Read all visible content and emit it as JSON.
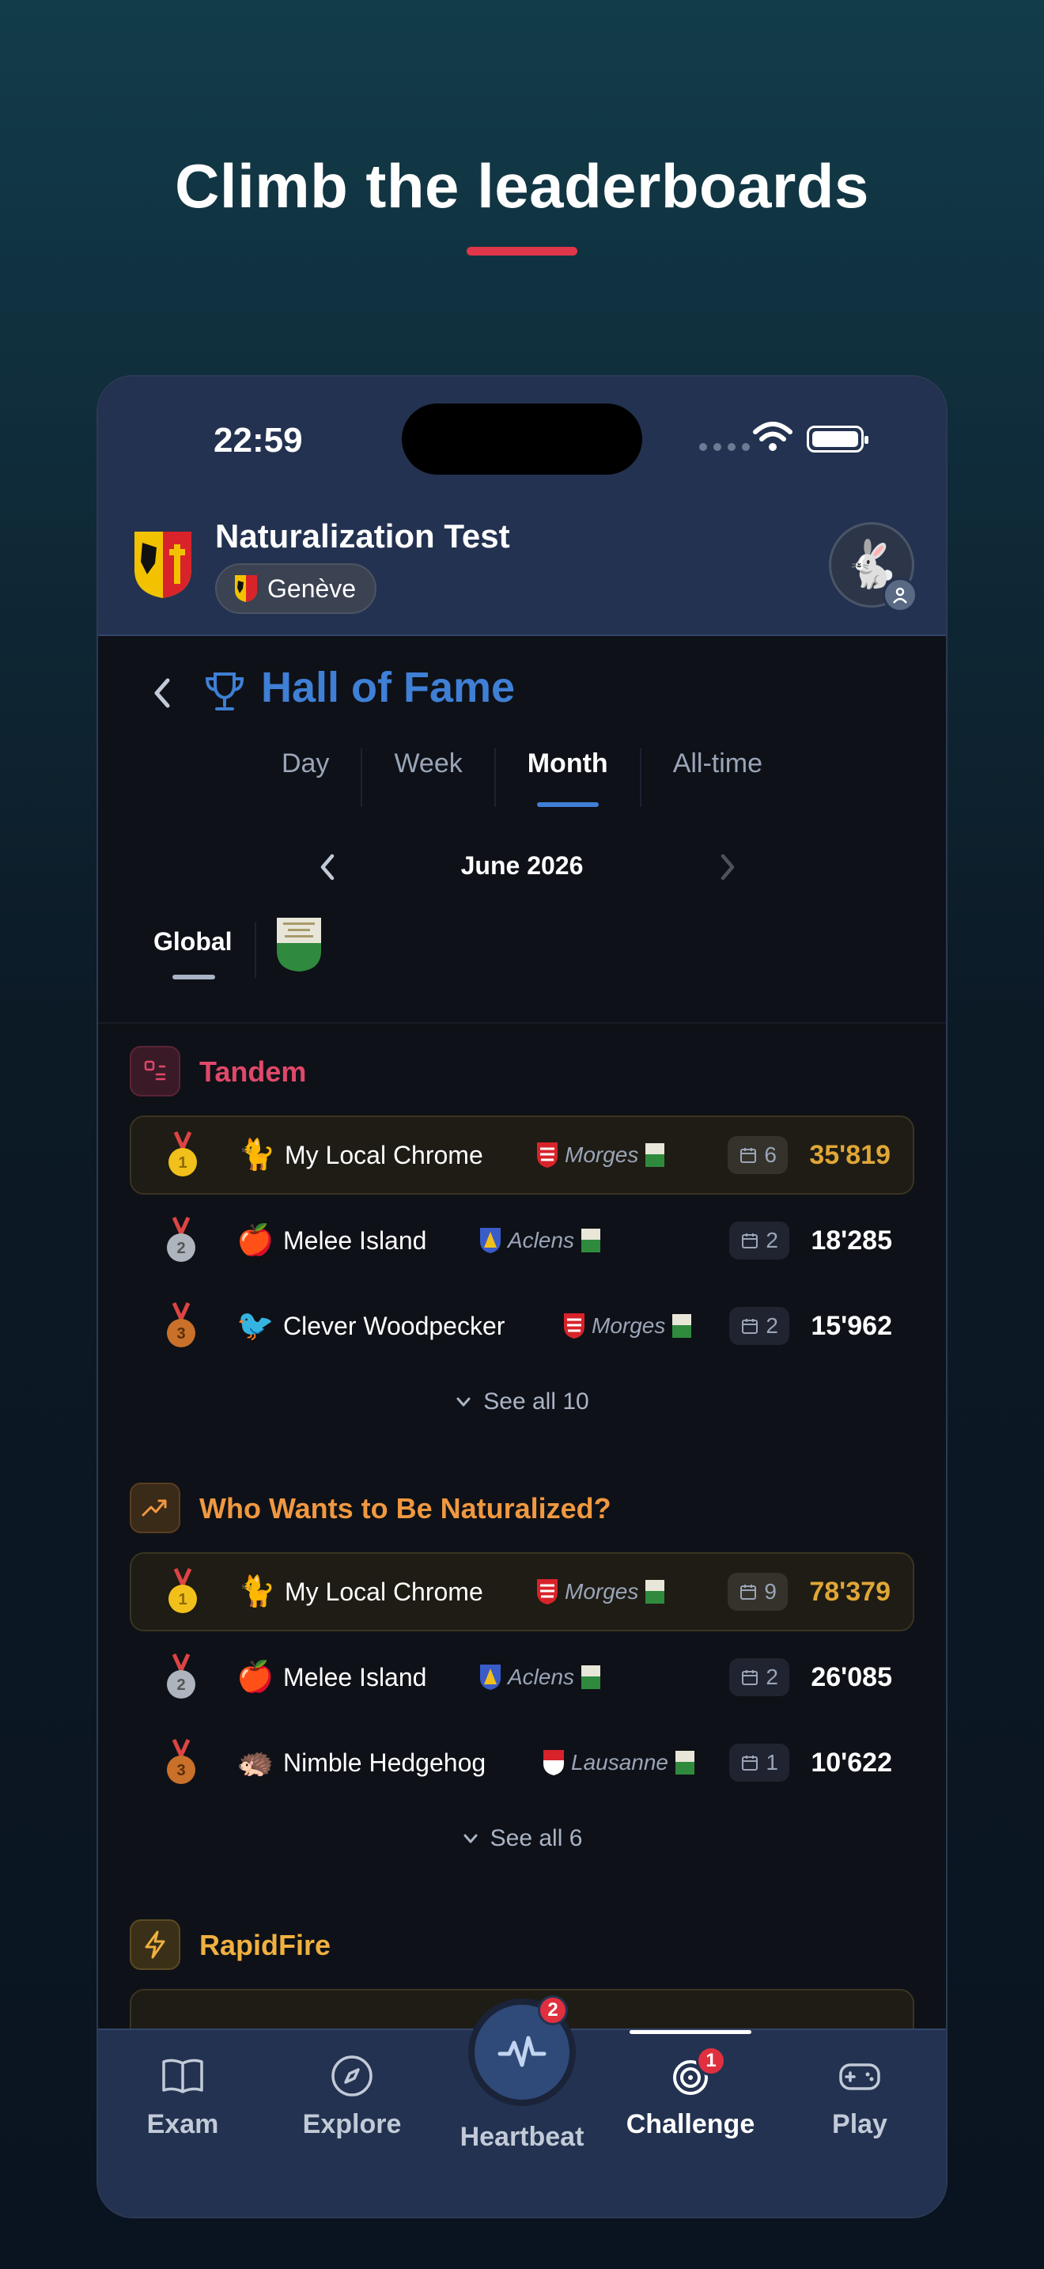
{
  "headline": "Climb the leaderboards",
  "status_bar": {
    "time": "22:59"
  },
  "header": {
    "app_title": "Naturalization Test",
    "canton": "Genève",
    "colors": {
      "bar": "#233250",
      "accent": "#3f7fd6"
    }
  },
  "page": {
    "title": "Hall of Fame",
    "tabs": [
      {
        "label": "Day",
        "active": false
      },
      {
        "label": "Week",
        "active": false
      },
      {
        "label": "Month",
        "active": true
      },
      {
        "label": "All-time",
        "active": false
      }
    ],
    "period": "June 2026",
    "scope_global": "Global"
  },
  "sections": [
    {
      "title": "Tandem",
      "color": "#e0486a",
      "icon": "puzzle-icon",
      "rows": [
        {
          "rank": 1,
          "animal": "🐈",
          "name": "My Local Chrome",
          "location": "Morges",
          "days": "6",
          "score": "35'819"
        },
        {
          "rank": 2,
          "animal": "🍎",
          "name": "Melee Island",
          "location": "Aclens",
          "days": "2",
          "score": "18'285"
        },
        {
          "rank": 3,
          "animal": "🐦",
          "name": "Clever Woodpecker",
          "location": "Morges",
          "days": "2",
          "score": "15'962"
        }
      ],
      "see_all": "See all 10"
    },
    {
      "title": "Who Wants to Be Naturalized?",
      "color": "#f09840",
      "icon": "trending-up-icon",
      "rows": [
        {
          "rank": 1,
          "animal": "🐈",
          "name": "My Local Chrome",
          "location": "Morges",
          "days": "9",
          "score": "78'379"
        },
        {
          "rank": 2,
          "animal": "🍎",
          "name": "Melee Island",
          "location": "Aclens",
          "days": "2",
          "score": "26'085"
        },
        {
          "rank": 3,
          "animal": "🦔",
          "name": "Nimble Hedgehog",
          "location": "Lausanne",
          "days": "1",
          "score": "10'622"
        }
      ],
      "see_all": "See all 6"
    },
    {
      "title": "RapidFire",
      "color": "#f0b040",
      "icon": "lightning-icon"
    }
  ],
  "bottom_nav": {
    "items": [
      {
        "label": "Exam",
        "icon": "book-icon"
      },
      {
        "label": "Explore",
        "icon": "compass-icon"
      },
      {
        "label": "Heartbeat",
        "icon": "pulse-icon",
        "badge": "2"
      },
      {
        "label": "Challenge",
        "icon": "target-icon",
        "badge": "1",
        "active": true
      },
      {
        "label": "Play",
        "icon": "gamepad-icon"
      }
    ]
  }
}
